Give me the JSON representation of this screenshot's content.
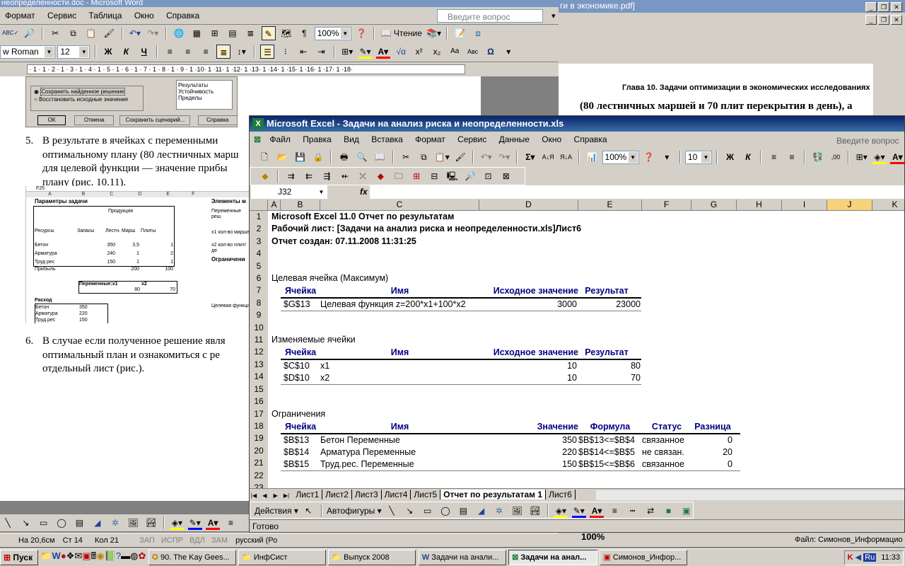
{
  "word": {
    "title": "неопределенности.doc - Microsoft Word",
    "menu": [
      "Формат",
      "Сервис",
      "Таблица",
      "Окно",
      "Справка"
    ],
    "help_placeholder": "Введите вопрос",
    "zoom": "100%",
    "read_label": "Чтение",
    "font_name": "w Roman",
    "font_size": "12",
    "dialog": {
      "radio_save": "Сохранить найденное решение",
      "radio_restore": "Восстановить исходные значения",
      "list": [
        "Результаты",
        "Устойчивость",
        "Пределы"
      ],
      "ok": "ОК",
      "cancel": "Отмена",
      "save_scenario": "Сохранить сценарий...",
      "help": "Справка"
    },
    "para5_num": "5.",
    "para5_lines": [
      "В результате в ячейках с переменными",
      "оптимальному плану (80 лестничных марш",
      "для целевой функции — значение прибы",
      "плану (рис. 10.11)."
    ],
    "para6_num": "6.",
    "para6_lines": [
      "В случае если полученное решение явля",
      "оптимальный план и ознакомиться с ре",
      "отдельный лист (рис.)."
    ],
    "fig_title": "Параметры задачи",
    "fig_rows": [
      [
        "Ресурсы",
        "Запасы",
        "Лестн. Марш",
        "Плиты"
      ],
      [
        "Бетон",
        "350",
        "3,5",
        "1"
      ],
      [
        "Арматура",
        "240",
        "1",
        "2"
      ],
      [
        "Труд рес",
        "150",
        "1",
        "1"
      ],
      [
        "Прибыль",
        "",
        "200",
        "100"
      ]
    ],
    "fig_extra": {
      "produkcia": "Продукция",
      "variables": "Переменные:х1",
      "x2": "х2",
      "v1": "80",
      "v2": "70",
      "rashod": "Расход",
      "r1": [
        "Бетон",
        "350"
      ],
      "r2": [
        "Арматура",
        "220"
      ],
      "r3": [
        "Труд.рес",
        "150"
      ],
      "elems": "Элементы м",
      "per_resh": "Переменные реш",
      "x1_label": "х1 кол-во марше",
      "x2_label": "х2 кол-во плит/де",
      "ogr": "Ограничени",
      "cel": "Целевая функци",
      "cell_ref": "F25"
    },
    "status": {
      "pos": "На 20,6см",
      "line": "Ст 14",
      "col": "Кол 21",
      "zap": "ЗАП",
      "ispr": "ИСПР",
      "vdl": "ВДЛ",
      "zam": "ЗАМ",
      "lang": "русский (Ро"
    }
  },
  "pdf": {
    "title": "ги в экономике.pdf]",
    "heading": "Глава 10. Задачи оптимизации в экономических исследованиях",
    "line1": "(80 лестничных маршей и 70 плит перекрытия в день), а"
  },
  "excel": {
    "title": "Microsoft Excel - Задачи на анализ риска и неопределенности.xls",
    "menu": [
      "Файл",
      "Правка",
      "Вид",
      "Вставка",
      "Формат",
      "Сервис",
      "Данные",
      "Окно",
      "Справка"
    ],
    "help_placeholder": "Введите вопрос",
    "zoom": "100%",
    "font_size": "10",
    "name_box": "J32",
    "fx": "fx",
    "columns": [
      "A",
      "B",
      "C",
      "D",
      "E",
      "F",
      "G",
      "H",
      "I",
      "J",
      "K"
    ],
    "row_numbers": [
      "1",
      "2",
      "3",
      "4",
      "5",
      "6",
      "7",
      "8",
      "9",
      "10",
      "11",
      "12",
      "13",
      "14",
      "15",
      "16",
      "17",
      "18",
      "19",
      "20",
      "21",
      "22",
      "23"
    ],
    "report_title": "Microsoft Excel 11.0 Отчет по результатам",
    "worksheet": "Рабочий лист: [Задачи на анализ риска и неопределенности.xls]Лист6",
    "created": "Отчет создан: 07.11.2008 11:31:25",
    "target_section": "Целевая ячейка (Максимум)",
    "changing_section": "Изменяемые ячейки",
    "constraints_section": "Ограничения",
    "headers": {
      "cell": "Ячейка",
      "name": "Имя",
      "initial": "Исходное значение",
      "result": "Результат",
      "value": "Значение",
      "formula": "Формула",
      "status": "Статус",
      "slack": "Разница"
    },
    "target_row": [
      "$G$13",
      "Целевая функция z=200*x1+100*x2",
      "3000",
      "23000"
    ],
    "changing_rows": [
      [
        "$C$10",
        "x1",
        "10",
        "80"
      ],
      [
        "$D$10",
        "x2",
        "10",
        "70"
      ]
    ],
    "constraint_rows": [
      [
        "$B$13",
        "Бетон Переменные",
        "350",
        "$B$13<=$B$4",
        "связанное",
        "0"
      ],
      [
        "$B$14",
        "Арматура Переменные",
        "220",
        "$B$14<=$B$5",
        "не связан.",
        "20"
      ],
      [
        "$B$15",
        "Труд.рес. Переменные",
        "150",
        "$B$15<=$B$6",
        "связанное",
        "0"
      ]
    ],
    "sheets": [
      "Лист1",
      "Лист2",
      "Лист3",
      "Лист4",
      "Лист5",
      "Отчет по результатам 1",
      "Лист6"
    ],
    "draw_actions": "Действия",
    "autoshapes": "Автофигуры",
    "status": "Готово"
  },
  "pdf_status": {
    "zoom": "100%",
    "file": "Файл: Симонов_Информацио"
  },
  "taskbar": {
    "start": "Пуск",
    "tasks": [
      "90. The Kay Gees...",
      "ИнфСист",
      "Выпуск 2008",
      "Задачи на анали...",
      "Задачи на анал...",
      "Симонов_Инфор..."
    ],
    "lang": "Ru",
    "clock": "11:33"
  }
}
